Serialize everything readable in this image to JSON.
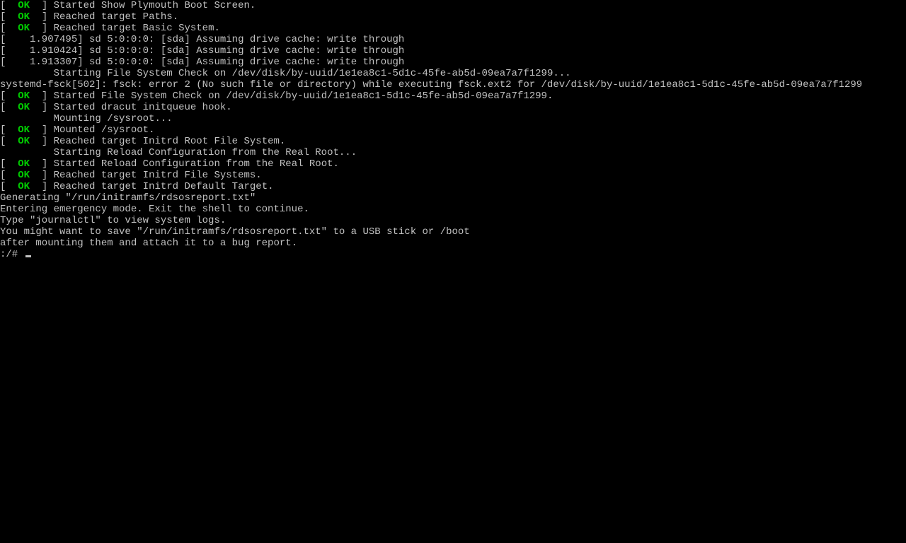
{
  "lines": [
    {
      "status": "OK",
      "text": "Started Show Plymouth Boot Screen."
    },
    {
      "status": "OK",
      "text": "Reached target Paths."
    },
    {
      "status": "OK",
      "text": "Reached target Basic System."
    },
    {
      "time": "1.907495",
      "text": "sd 5:0:0:0: [sda] Assuming drive cache: write through"
    },
    {
      "time": "1.910424",
      "text": "sd 5:0:0:0: [sda] Assuming drive cache: write through"
    },
    {
      "time": "1.913307",
      "text": "sd 5:0:0:0: [sda] Assuming drive cache: write through"
    },
    {
      "indent": true,
      "text": "Starting File System Check on /dev/disk/by-uuid/1e1ea8c1-5d1c-45fe-ab5d-09ea7a7f1299..."
    },
    {
      "raw": "systemd-fsck[502]: fsck: error 2 (No such file or directory) while executing fsck.ext2 for /dev/disk/by-uuid/1e1ea8c1-5d1c-45fe-ab5d-09ea7a7f1299"
    },
    {
      "status": "OK",
      "text": "Started File System Check on /dev/disk/by-uuid/1e1ea8c1-5d1c-45fe-ab5d-09ea7a7f1299."
    },
    {
      "status": "OK",
      "text": "Started dracut initqueue hook."
    },
    {
      "indent": true,
      "text": "Mounting /sysroot..."
    },
    {
      "status": "OK",
      "text": "Mounted /sysroot."
    },
    {
      "status": "OK",
      "text": "Reached target Initrd Root File System."
    },
    {
      "indent": true,
      "text": "Starting Reload Configuration from the Real Root..."
    },
    {
      "status": "OK",
      "text": "Started Reload Configuration from the Real Root."
    },
    {
      "status": "OK",
      "text": "Reached target Initrd File Systems."
    },
    {
      "status": "OK",
      "text": "Reached target Initrd Default Target."
    },
    {
      "raw": ""
    },
    {
      "raw": "Generating \"/run/initramfs/rdsosreport.txt\""
    },
    {
      "raw": ""
    },
    {
      "raw": ""
    },
    {
      "raw": "Entering emergency mode. Exit the shell to continue."
    },
    {
      "raw": "Type \"journalctl\" to view system logs."
    },
    {
      "raw": "You might want to save \"/run/initramfs/rdsosreport.txt\" to a USB stick or /boot"
    },
    {
      "raw": "after mounting them and attach it to a bug report."
    },
    {
      "raw": ""
    },
    {
      "raw": ""
    }
  ],
  "prompt": ":/# ",
  "bracket_open": "[",
  "bracket_close": "]",
  "ok_label": "OK"
}
